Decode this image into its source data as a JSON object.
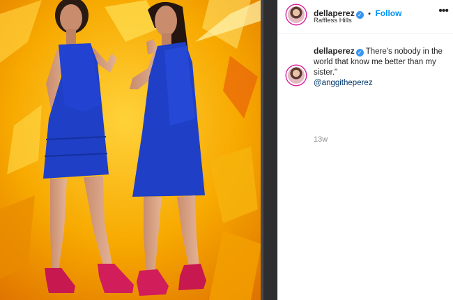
{
  "post": {
    "author": "dellaperez",
    "follow_label": "Follow",
    "dot": "•",
    "location": "Raffless Hills",
    "more_icon": "more-options-icon"
  },
  "caption": {
    "author": "dellaperez",
    "text": "There's nobody in the world that know me better than my sister.\"",
    "mention": "@anggitheperez",
    "time": "13w"
  },
  "colors": {
    "accent_blue": "#0095f6",
    "verified_blue": "#3897f0",
    "dress_blue": "#1f3fc7",
    "background_orange": "#f0a000",
    "heels_pink": "#d11d5a"
  }
}
